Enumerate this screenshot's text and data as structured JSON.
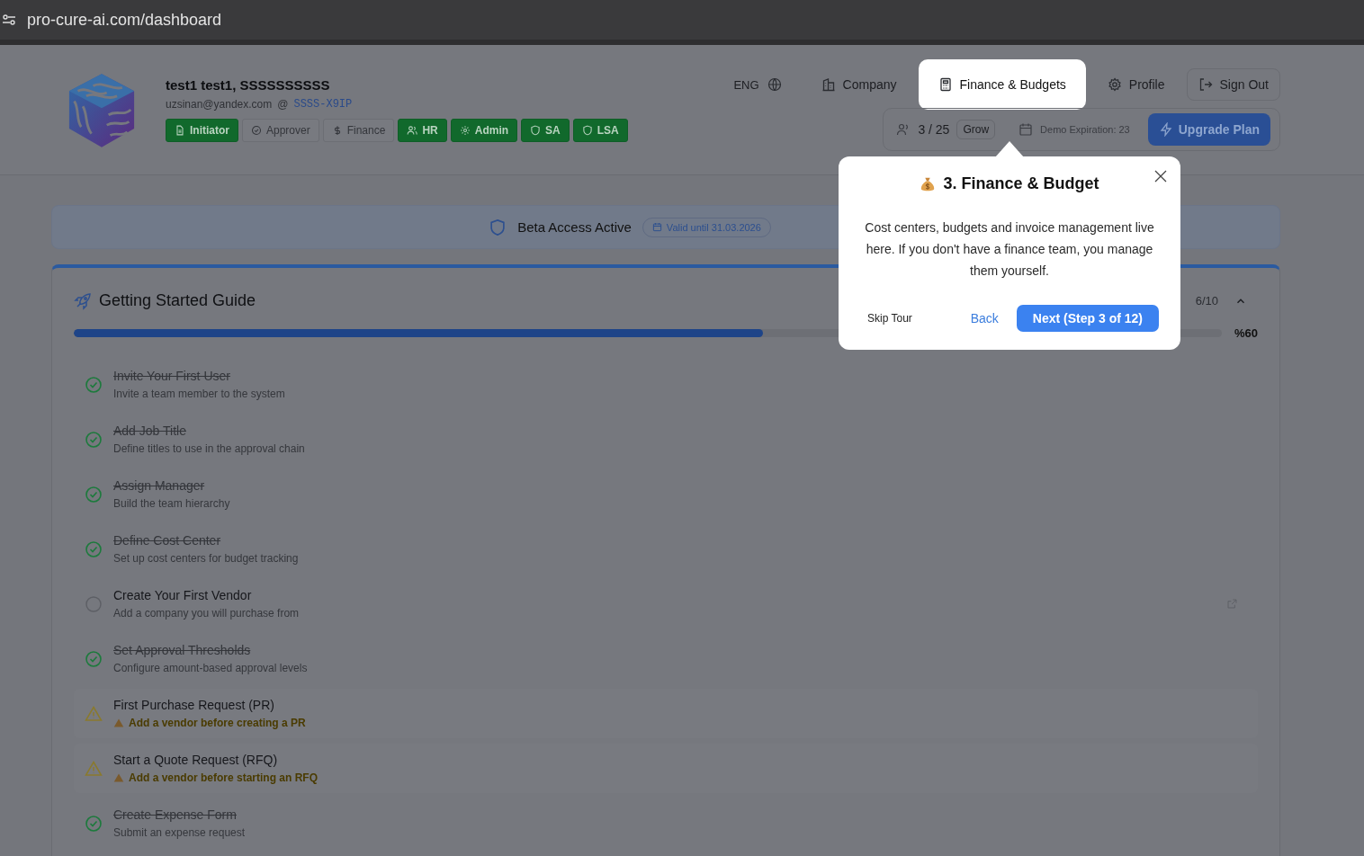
{
  "browser": {
    "url": "pro-cure-ai.com/dashboard"
  },
  "user": {
    "name": "test1 test1, SSSSSSSSSS",
    "email": "uzsinan@yandex.com",
    "at": "@",
    "code": "SSSS-X9IP"
  },
  "roles": [
    {
      "label": "Initiator",
      "active": true
    },
    {
      "label": "Approver",
      "active": false
    },
    {
      "label": "Finance",
      "active": false
    },
    {
      "label": "HR",
      "active": true
    },
    {
      "label": "Admin",
      "active": true
    },
    {
      "label": "SA",
      "active": true
    },
    {
      "label": "LSA",
      "active": true
    }
  ],
  "nav": {
    "language": "ENG",
    "items": [
      {
        "label": "Company",
        "selected": false
      },
      {
        "label": "Finance & Budgets",
        "selected": true
      },
      {
        "label": "Profile",
        "selected": false
      }
    ],
    "sign_out": "Sign Out"
  },
  "plan": {
    "users": "3 / 25",
    "tier": "Grow",
    "demo": "Demo Expiration: 23",
    "upgrade": "Upgrade Plan"
  },
  "banner": {
    "title": "Beta Access Active",
    "valid": "Valid until 31.03.2026"
  },
  "guide": {
    "title": "Getting Started Guide",
    "count": "6/10",
    "expanded": true,
    "level": 0.6,
    "percent": "%60",
    "items": [
      {
        "kind": "done",
        "title": "Invite Your First User",
        "subtitle": "Invite a team member to the system"
      },
      {
        "kind": "done",
        "title": "Add Job Title",
        "subtitle": "Define titles to use in the approval chain"
      },
      {
        "kind": "done",
        "title": "Assign Manager",
        "subtitle": "Build the team hierarchy"
      },
      {
        "kind": "done",
        "title": "Define Cost Center",
        "subtitle": "Set up cost centers for budget tracking"
      },
      {
        "kind": "pending",
        "title": "Create Your First Vendor",
        "subtitle": "Add a company you will purchase from"
      },
      {
        "kind": "done",
        "title": "Set Approval Thresholds",
        "subtitle": "Configure amount-based approval levels"
      },
      {
        "kind": "warning",
        "title": "First Purchase Request (PR)",
        "subtitle": "Add a vendor before creating a PR"
      },
      {
        "kind": "warning",
        "title": "Start a Quote Request (RFQ)",
        "subtitle": "Add a vendor before starting an RFQ"
      },
      {
        "kind": "done",
        "title": "Create Expense Form",
        "subtitle": "Submit an expense request"
      }
    ]
  },
  "tour": {
    "title": "3. Finance & Budget",
    "body": "Cost centers, budgets and invoice management live here. If you don't have a finance team, you manage them yourself.",
    "skip": "Skip Tour",
    "back": "Back",
    "next": "Next (Step 3 of 12)"
  }
}
